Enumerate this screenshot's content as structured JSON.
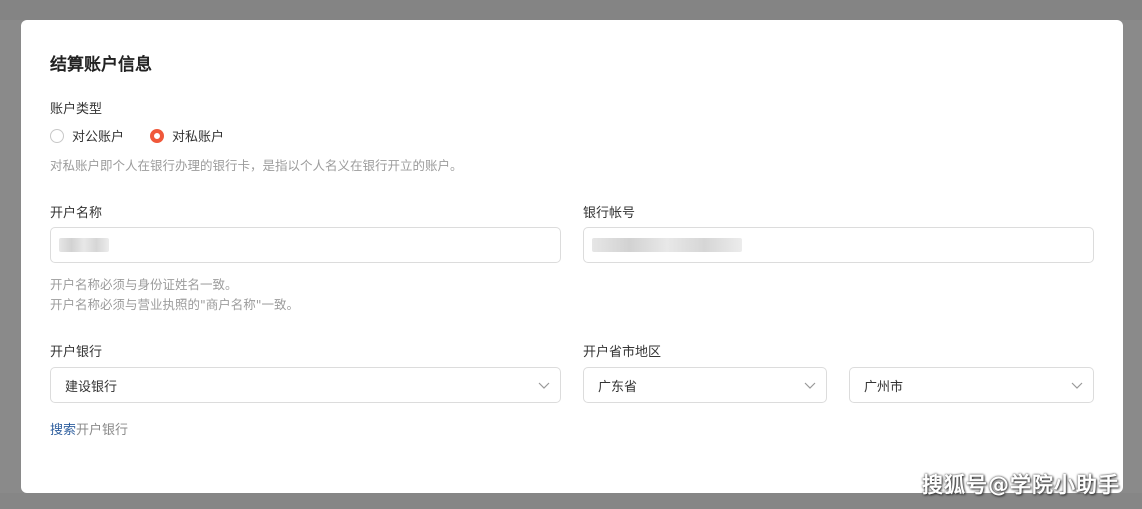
{
  "section_title": "结算账户信息",
  "account_type": {
    "label": "账户类型",
    "options": [
      "对公账户",
      "对私账户"
    ],
    "selected": "对私账户",
    "hint": "对私账户即个人在银行办理的银行卡，是指以个人名义在银行开立的账户。"
  },
  "account_name": {
    "label": "开户名称",
    "value": "",
    "hints": [
      "开户名称必须与身份证姓名一致。",
      "开户名称必须与营业执照的\"商户名称\"一致。"
    ]
  },
  "bank_account": {
    "label": "银行帐号",
    "value": ""
  },
  "bank": {
    "label": "开户银行",
    "value": "建设银行",
    "search_link": "搜索",
    "search_suffix": "开户银行"
  },
  "region": {
    "label": "开户省市地区",
    "province": "广东省",
    "city": "广州市"
  },
  "watermark": "搜狐号@学院小助手"
}
